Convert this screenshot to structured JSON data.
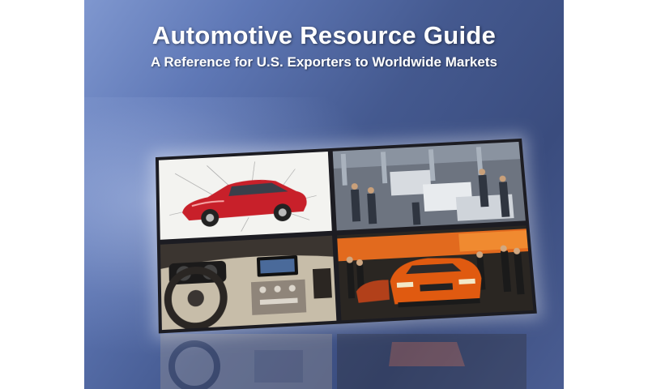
{
  "cover": {
    "title": "Automotive Resource Guide",
    "subtitle": "A Reference for U.S. Exporters to Worldwide Markets"
  },
  "collage": {
    "panels": [
      {
        "name": "red-car-diagram",
        "icon": "car-icon"
      },
      {
        "name": "assembly-line",
        "icon": "factory-icon"
      },
      {
        "name": "car-interior-dashboard",
        "icon": "dashboard-icon"
      },
      {
        "name": "auto-show-orange-car",
        "icon": "car-icon"
      }
    ]
  },
  "colors": {
    "background_dark": "#3a4c7e",
    "background_light": "#7f97cf",
    "title_text": "#ffffff",
    "car_red": "#c8202a",
    "car_orange": "#e05a10"
  }
}
